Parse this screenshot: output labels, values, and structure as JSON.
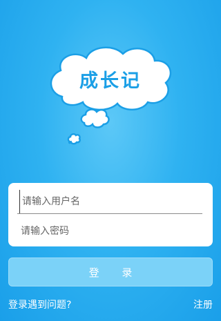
{
  "logo": {
    "title": "成长记"
  },
  "login": {
    "username_placeholder": "请输入用户名",
    "password_placeholder": "请输入密码",
    "login_label": "登 录",
    "help_link": "登录遇到问题?",
    "register_link": "注册"
  },
  "colors": {
    "background": "#2fb2f1",
    "accent": "#1b9fe6",
    "button": "#7bd2f8"
  }
}
